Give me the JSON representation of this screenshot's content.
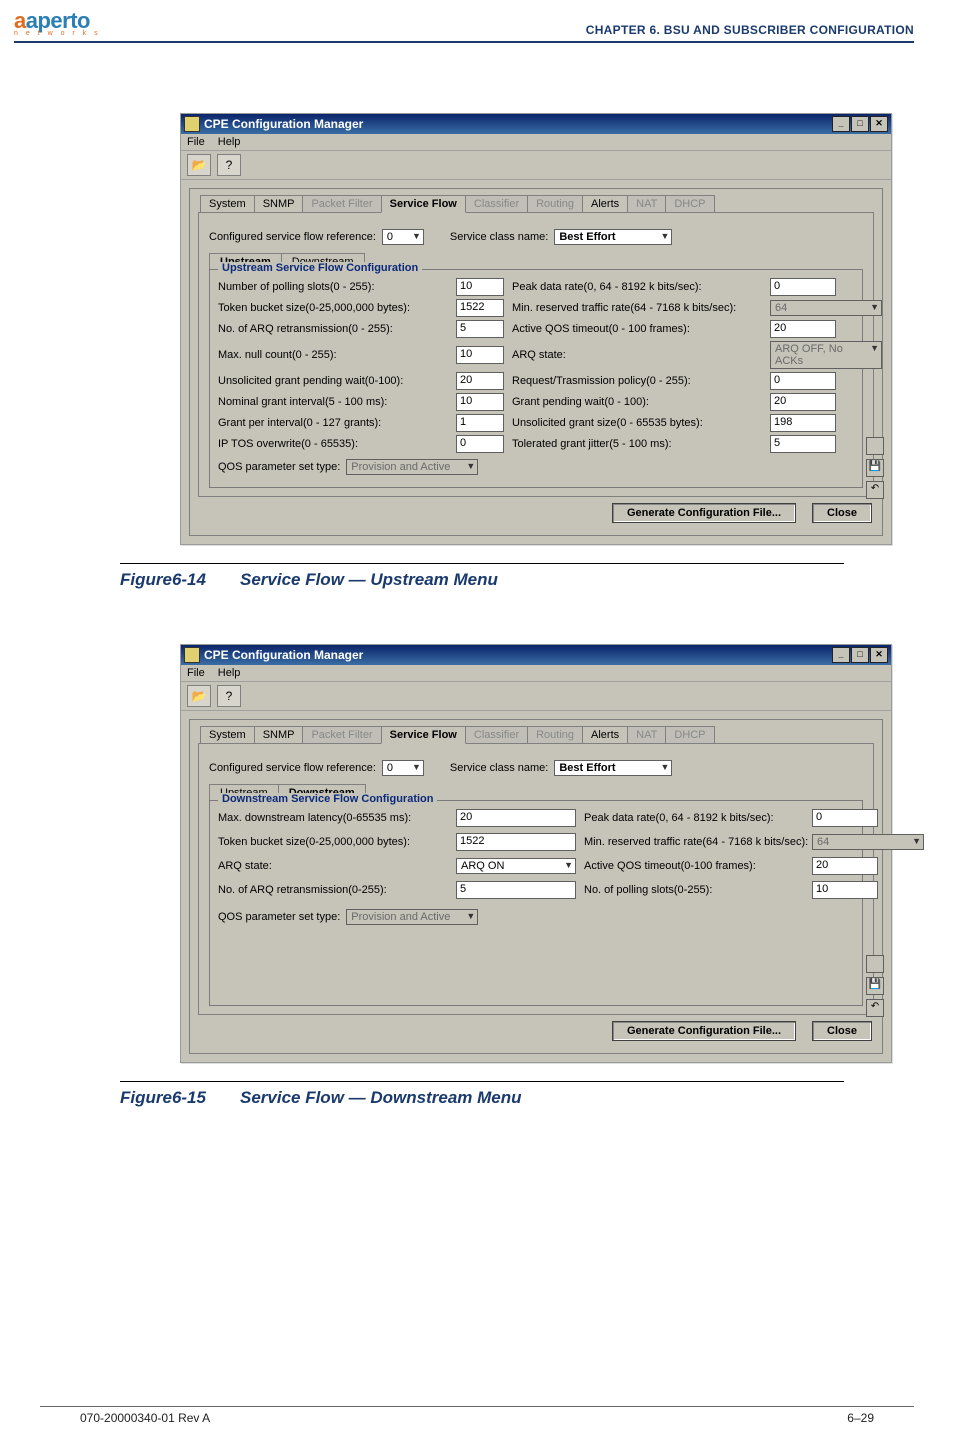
{
  "header": {
    "logo_main": "aperto",
    "logo_sub": "n e t w o r k s",
    "running": "CHAPTER 6.   BSU AND SUBSCRIBER CONFIGURATION"
  },
  "footer": {
    "left": "070-20000340-01 Rev A",
    "right": "6–29"
  },
  "fig1": {
    "num": "Figure6-14",
    "title": "Service Flow — Upstream Menu",
    "win_title": "CPE Configuration Manager",
    "menu": {
      "file": "File",
      "help": "Help"
    },
    "tabs": [
      "System",
      "SNMP",
      "Packet Filter",
      "Service Flow",
      "Classifier",
      "Routing",
      "Alerts",
      "NAT",
      "DHCP"
    ],
    "active_tab": 3,
    "disabled_tabs": [
      2,
      4,
      5,
      7,
      8
    ],
    "cfg_ref_label": "Configured service flow reference:",
    "cfg_ref_value": "0",
    "svc_class_label": "Service class name:",
    "svc_class_value": "Best Effort",
    "subtabs": [
      "Upstream",
      "Downstream"
    ],
    "sub_active": 0,
    "gbox_title": "Upstream Service Flow Configuration",
    "left_fields": [
      {
        "l": "Number of polling slots(0 - 255):",
        "v": "10"
      },
      {
        "l": "Token bucket size(0-25,000,000 bytes):",
        "v": "1522"
      },
      {
        "l": "No. of ARQ retransmission(0 - 255):",
        "v": "5"
      },
      {
        "l": "Max. null count(0 - 255):",
        "v": "10"
      },
      {
        "l": "Unsolicited grant pending wait(0-100):",
        "v": "20"
      },
      {
        "l": "Nominal grant interval(5 - 100 ms):",
        "v": "10"
      },
      {
        "l": "Grant per interval(0 - 127 grants):",
        "v": "1"
      },
      {
        "l": "IP TOS overwrite(0 - 65535):",
        "v": "0"
      }
    ],
    "right_fields": [
      {
        "l": "Peak data rate(0, 64 - 8192 k bits/sec):",
        "v": "0"
      },
      {
        "l": "Min. reserved traffic rate(64 - 7168 k bits/sec):",
        "v": "64",
        "dis": true,
        "sel": true
      },
      {
        "l": "Active QOS timeout(0 - 100 frames):",
        "v": "20"
      },
      {
        "l": "ARQ state:",
        "v": "ARQ OFF, No ACKs",
        "dis": true,
        "sel": true
      },
      {
        "l": "Request/Trasmission policy(0 - 255):",
        "v": "0"
      },
      {
        "l": "Grant pending wait(0 - 100):",
        "v": "20"
      },
      {
        "l": "Unsolicited grant size(0 - 65535 bytes):",
        "v": "198"
      },
      {
        "l": "Tolerated grant jitter(5 - 100 ms):",
        "v": "5"
      }
    ],
    "qos_label": "QOS parameter set type:",
    "qos_value": "Provision and Active",
    "btn_gen": "Generate Configuration File...",
    "btn_close": "Close"
  },
  "fig2": {
    "num": "Figure6-15",
    "title": "Service Flow — Downstream Menu",
    "win_title": "CPE Configuration Manager",
    "menu": {
      "file": "File",
      "help": "Help"
    },
    "tabs": [
      "System",
      "SNMP",
      "Packet Filter",
      "Service Flow",
      "Classifier",
      "Routing",
      "Alerts",
      "NAT",
      "DHCP"
    ],
    "active_tab": 3,
    "disabled_tabs": [
      2,
      4,
      5,
      7,
      8
    ],
    "cfg_ref_label": "Configured service flow reference:",
    "cfg_ref_value": "0",
    "svc_class_label": "Service class name:",
    "svc_class_value": "Best Effort",
    "subtabs": [
      "Upstream",
      "Downstream"
    ],
    "sub_active": 1,
    "gbox_title": "Downstream Service Flow Configuration",
    "left_fields": [
      {
        "l": "Max. downstream latency(0-65535 ms):",
        "v": "20"
      },
      {
        "l": "Token bucket size(0-25,000,000 bytes):",
        "v": "1522"
      },
      {
        "l": "ARQ state:",
        "v": "ARQ ON",
        "sel": true
      },
      {
        "l": "No. of ARQ retransmission(0-255):",
        "v": "5"
      }
    ],
    "right_fields": [
      {
        "l": "Peak data rate(0, 64 - 8192 k bits/sec):",
        "v": "0"
      },
      {
        "l": "Min. reserved traffic rate(64 - 7168 k bits/sec):",
        "v": "64",
        "dis": true,
        "sel": true
      },
      {
        "l": "Active QOS timeout(0-100 frames):",
        "v": "20"
      },
      {
        "l": "No. of polling slots(0-255):",
        "v": "10"
      }
    ],
    "qos_label": "QOS parameter set type:",
    "qos_value": "Provision and Active",
    "btn_gen": "Generate Configuration File...",
    "btn_close": "Close"
  }
}
